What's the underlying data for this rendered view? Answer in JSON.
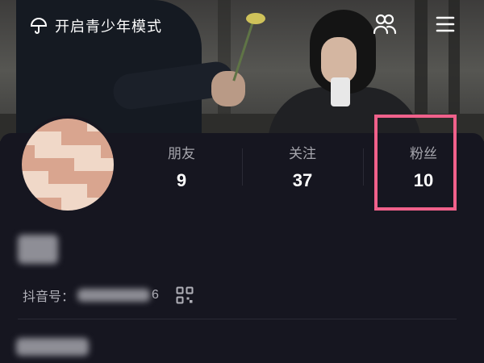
{
  "header": {
    "teen_mode_label": "开启青少年模式",
    "icons": {
      "teen": "umbrella-icon",
      "friends": "friends-icon",
      "menu": "menu-icon"
    }
  },
  "profile": {
    "stats": [
      {
        "label": "朋友",
        "value": "9"
      },
      {
        "label": "关注",
        "value": "37"
      },
      {
        "label": "粉丝",
        "value": "10"
      }
    ],
    "douyin_id_label": "抖音号：",
    "douyin_id_visible_tail": "6",
    "qr_icon": "qrcode-icon"
  },
  "colors": {
    "background": "#161620",
    "highlight_box": "#f0618b",
    "stat_label": "#a6a6ad",
    "stat_value": "#ffffff"
  }
}
